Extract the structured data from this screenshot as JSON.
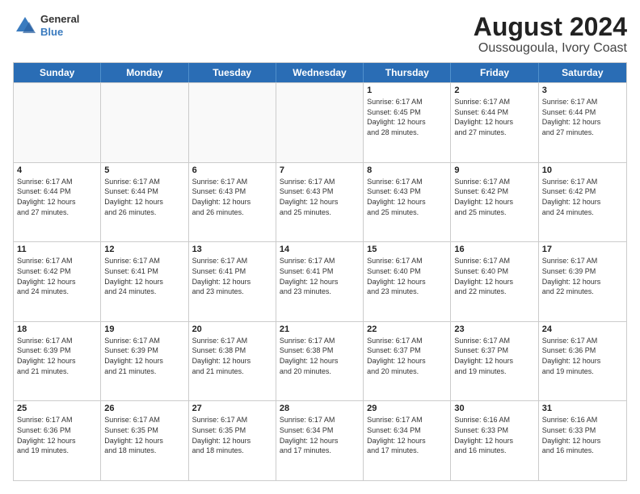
{
  "logo": {
    "general": "General",
    "blue": "Blue"
  },
  "title": "August 2024",
  "subtitle": "Oussougoula, Ivory Coast",
  "days": [
    "Sunday",
    "Monday",
    "Tuesday",
    "Wednesday",
    "Thursday",
    "Friday",
    "Saturday"
  ],
  "weeks": [
    [
      {
        "day": "",
        "info": ""
      },
      {
        "day": "",
        "info": ""
      },
      {
        "day": "",
        "info": ""
      },
      {
        "day": "",
        "info": ""
      },
      {
        "day": "1",
        "info": "Sunrise: 6:17 AM\nSunset: 6:45 PM\nDaylight: 12 hours\nand 28 minutes."
      },
      {
        "day": "2",
        "info": "Sunrise: 6:17 AM\nSunset: 6:44 PM\nDaylight: 12 hours\nand 27 minutes."
      },
      {
        "day": "3",
        "info": "Sunrise: 6:17 AM\nSunset: 6:44 PM\nDaylight: 12 hours\nand 27 minutes."
      }
    ],
    [
      {
        "day": "4",
        "info": "Sunrise: 6:17 AM\nSunset: 6:44 PM\nDaylight: 12 hours\nand 27 minutes."
      },
      {
        "day": "5",
        "info": "Sunrise: 6:17 AM\nSunset: 6:44 PM\nDaylight: 12 hours\nand 26 minutes."
      },
      {
        "day": "6",
        "info": "Sunrise: 6:17 AM\nSunset: 6:43 PM\nDaylight: 12 hours\nand 26 minutes."
      },
      {
        "day": "7",
        "info": "Sunrise: 6:17 AM\nSunset: 6:43 PM\nDaylight: 12 hours\nand 25 minutes."
      },
      {
        "day": "8",
        "info": "Sunrise: 6:17 AM\nSunset: 6:43 PM\nDaylight: 12 hours\nand 25 minutes."
      },
      {
        "day": "9",
        "info": "Sunrise: 6:17 AM\nSunset: 6:42 PM\nDaylight: 12 hours\nand 25 minutes."
      },
      {
        "day": "10",
        "info": "Sunrise: 6:17 AM\nSunset: 6:42 PM\nDaylight: 12 hours\nand 24 minutes."
      }
    ],
    [
      {
        "day": "11",
        "info": "Sunrise: 6:17 AM\nSunset: 6:42 PM\nDaylight: 12 hours\nand 24 minutes."
      },
      {
        "day": "12",
        "info": "Sunrise: 6:17 AM\nSunset: 6:41 PM\nDaylight: 12 hours\nand 24 minutes."
      },
      {
        "day": "13",
        "info": "Sunrise: 6:17 AM\nSunset: 6:41 PM\nDaylight: 12 hours\nand 23 minutes."
      },
      {
        "day": "14",
        "info": "Sunrise: 6:17 AM\nSunset: 6:41 PM\nDaylight: 12 hours\nand 23 minutes."
      },
      {
        "day": "15",
        "info": "Sunrise: 6:17 AM\nSunset: 6:40 PM\nDaylight: 12 hours\nand 23 minutes."
      },
      {
        "day": "16",
        "info": "Sunrise: 6:17 AM\nSunset: 6:40 PM\nDaylight: 12 hours\nand 22 minutes."
      },
      {
        "day": "17",
        "info": "Sunrise: 6:17 AM\nSunset: 6:39 PM\nDaylight: 12 hours\nand 22 minutes."
      }
    ],
    [
      {
        "day": "18",
        "info": "Sunrise: 6:17 AM\nSunset: 6:39 PM\nDaylight: 12 hours\nand 21 minutes."
      },
      {
        "day": "19",
        "info": "Sunrise: 6:17 AM\nSunset: 6:39 PM\nDaylight: 12 hours\nand 21 minutes."
      },
      {
        "day": "20",
        "info": "Sunrise: 6:17 AM\nSunset: 6:38 PM\nDaylight: 12 hours\nand 21 minutes."
      },
      {
        "day": "21",
        "info": "Sunrise: 6:17 AM\nSunset: 6:38 PM\nDaylight: 12 hours\nand 20 minutes."
      },
      {
        "day": "22",
        "info": "Sunrise: 6:17 AM\nSunset: 6:37 PM\nDaylight: 12 hours\nand 20 minutes."
      },
      {
        "day": "23",
        "info": "Sunrise: 6:17 AM\nSunset: 6:37 PM\nDaylight: 12 hours\nand 19 minutes."
      },
      {
        "day": "24",
        "info": "Sunrise: 6:17 AM\nSunset: 6:36 PM\nDaylight: 12 hours\nand 19 minutes."
      }
    ],
    [
      {
        "day": "25",
        "info": "Sunrise: 6:17 AM\nSunset: 6:36 PM\nDaylight: 12 hours\nand 19 minutes."
      },
      {
        "day": "26",
        "info": "Sunrise: 6:17 AM\nSunset: 6:35 PM\nDaylight: 12 hours\nand 18 minutes."
      },
      {
        "day": "27",
        "info": "Sunrise: 6:17 AM\nSunset: 6:35 PM\nDaylight: 12 hours\nand 18 minutes."
      },
      {
        "day": "28",
        "info": "Sunrise: 6:17 AM\nSunset: 6:34 PM\nDaylight: 12 hours\nand 17 minutes."
      },
      {
        "day": "29",
        "info": "Sunrise: 6:17 AM\nSunset: 6:34 PM\nDaylight: 12 hours\nand 17 minutes."
      },
      {
        "day": "30",
        "info": "Sunrise: 6:16 AM\nSunset: 6:33 PM\nDaylight: 12 hours\nand 16 minutes."
      },
      {
        "day": "31",
        "info": "Sunrise: 6:16 AM\nSunset: 6:33 PM\nDaylight: 12 hours\nand 16 minutes."
      }
    ]
  ]
}
